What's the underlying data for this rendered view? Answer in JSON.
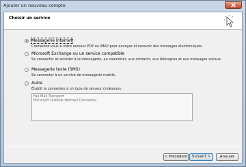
{
  "window": {
    "title": "Ajouter un nouveau compte"
  },
  "header": {
    "title": "Choisir un service"
  },
  "options": [
    {
      "label": "Messagerie Internet",
      "description": "Connectez-vous à votre serveur POP ou IMAP pour envoyer et recevoir des messages électroniques.",
      "checked": true
    },
    {
      "label": "Microsoft Exchange ou un service compatible",
      "description": "Se connecter et accéder à la messagerie, au calendrier, aux contacts, aux télécopies et aux messages vocaux.",
      "checked": false
    },
    {
      "label": "Messagerie texte (SMS)",
      "description": "Se connecter à un service de messagerie mobile.",
      "checked": false
    },
    {
      "label": "Autre",
      "description": "Établit la connexion à un type de serveur ci-dessous.",
      "checked": false
    }
  ],
  "other_services": [
    "Fax Mail Transport",
    "Microsoft Outlook Hotmail Connector"
  ],
  "buttons": {
    "back": "< Précédent",
    "next": "Suivant >",
    "cancel": "Annuler"
  }
}
